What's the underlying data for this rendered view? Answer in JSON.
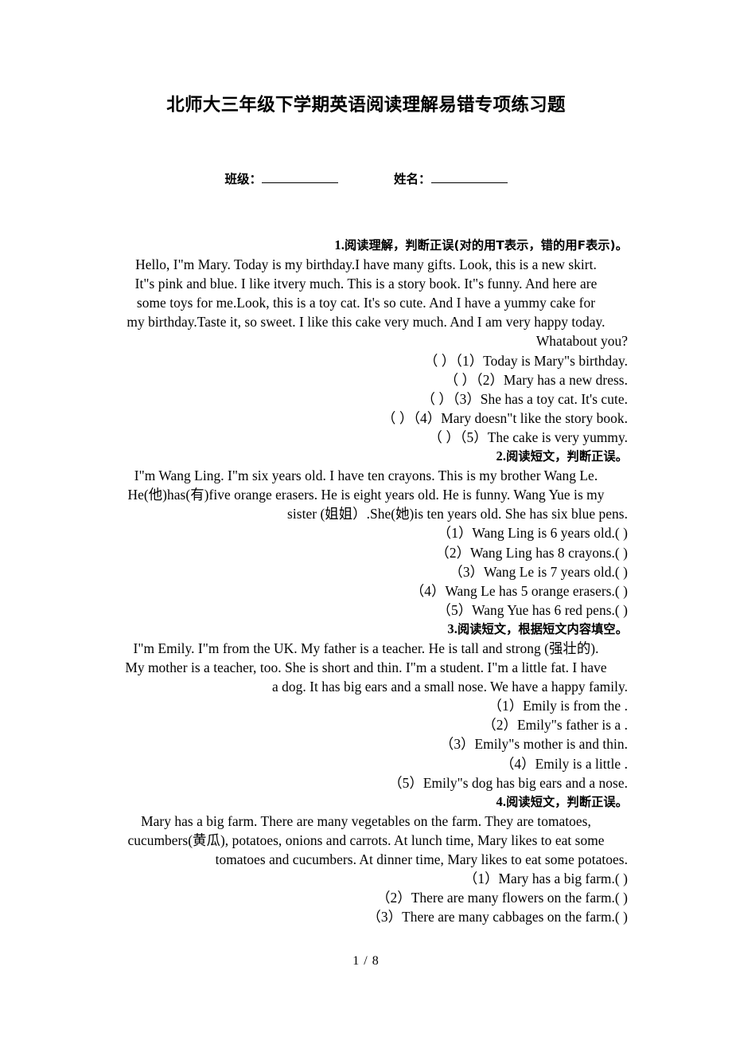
{
  "document": {
    "title": "北师大三年级下学期英语阅读理解易错专项练习题",
    "footer_page": "1 / 8"
  },
  "identity": {
    "class_label": "班级：",
    "name_label": "姓名："
  },
  "sections": [
    {
      "number": "1.",
      "heading": "阅读理解，判断正误(对的用T表示，错的用F表示)。",
      "passage_lines": [
        "Hello, I\"m Mary. Today is my birthday.I have many gifts. Look, this is a new skirt.",
        "It\"s pink and blue. I like itvery much. This is a story book. It\"s funny. And here are",
        "some toys for me.Look, this is a toy cat. It's so cute. And I have a yummy cake for",
        "my birthday.Taste it, so sweet. I like this cake very much. And I am very happy today.",
        "Whatabout you?"
      ],
      "questions": [
        "（ ）（1）Today is Mary\"s birthday.",
        "（ ）（2）Mary has a new dress.",
        "（ ）（3）She has a toy cat. It's cute.",
        "（ ）（4）Mary doesn\"t like the story book.",
        "（ ）（5）The cake is very yummy."
      ]
    },
    {
      "number": "2.",
      "heading": "阅读短文，判断正误。",
      "passage_lines": [
        "I\"m Wang Ling. I\"m six years old. I have ten crayons. This is my brother Wang Le.",
        "He(他)has(有)five orange erasers. He is eight years old. He is funny. Wang Yue is my",
        "sister (姐姐）.She(她)is ten years old. She has six blue pens."
      ],
      "questions": [
        "（1）Wang Ling is 6 years old.( )",
        "（2）Wang Ling has 8 crayons.( )",
        "（3）Wang Le is 7 years old.( )",
        "（4）Wang Le has 5 orange erasers.( )",
        "（5）Wang Yue has 6 red pens.( )"
      ]
    },
    {
      "number": "3.",
      "heading": "阅读短文，根据短文内容填空。",
      "passage_lines": [
        "I\"m Emily. I\"m from the UK. My father is a teacher. He is tall and strong (强壮的).",
        "My mother is a teacher, too. She is short and thin. I\"m a student. I\"m a little fat. I have",
        "a dog. It has big ears and a small nose. We have a happy family."
      ],
      "questions": [
        "（1）Emily is from the    .",
        "（2）Emily\"s father is a    .",
        "（3）Emily\"s mother is    and thin.",
        "（4）Emily is a little    .",
        "（5）Emily\"s dog has big ears and a    nose."
      ]
    },
    {
      "number": "4.",
      "heading": "阅读短文，判断正误。",
      "passage_lines": [
        "Mary has a big farm. There are many vegetables on the farm. They are tomatoes,",
        "cucumbers(黄瓜), potatoes, onions and carrots. At lunch time, Mary likes to eat some",
        "tomatoes and cucumbers. At dinner time, Mary likes to eat some potatoes."
      ],
      "questions": [
        "（1）Mary has a big farm.( )",
        "（2）There are many flowers on the farm.( )",
        "（3）There are many cabbages on the farm.( )"
      ]
    }
  ]
}
